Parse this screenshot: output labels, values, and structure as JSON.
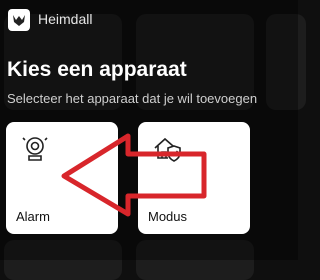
{
  "appbar": {
    "title": "Heimdall",
    "logo_icon": "heimdall-logo-icon"
  },
  "page": {
    "title": "Kies een apparaat",
    "subtitle": "Selecteer het apparaat dat je wil toevoegen"
  },
  "devices": [
    {
      "label": "Alarm",
      "icon": "alarm-siren-icon"
    },
    {
      "label": "Modus",
      "icon": "home-shield-icon"
    }
  ],
  "annotation": {
    "color": "#d8262b",
    "shape": "arrow-left"
  }
}
